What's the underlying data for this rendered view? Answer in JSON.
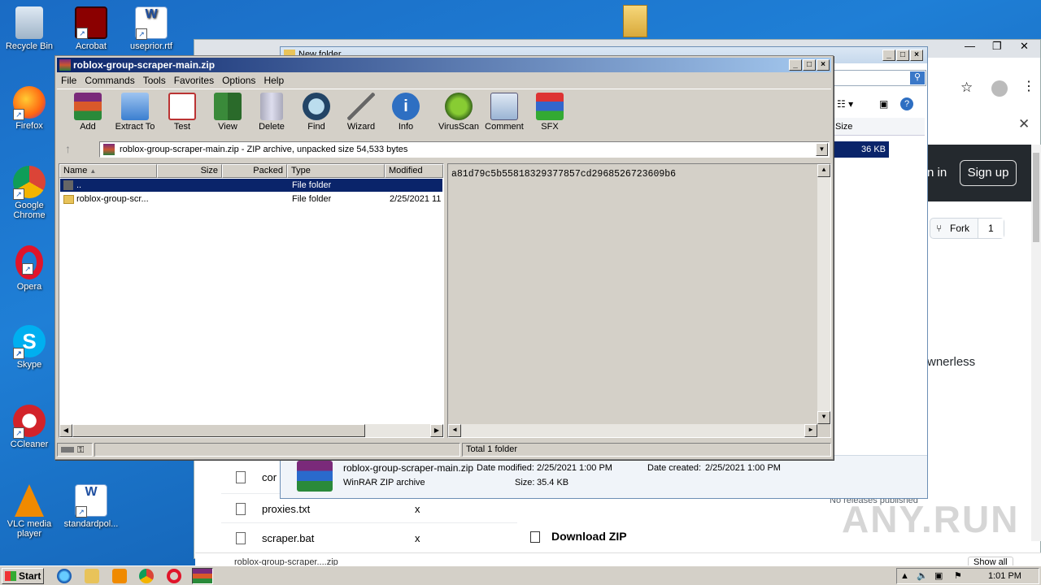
{
  "desktop": {
    "icons": [
      {
        "label": "Recycle Bin"
      },
      {
        "label": "Acrobat"
      },
      {
        "label": "useprior.rtf"
      },
      {
        "label": "Firefox"
      },
      {
        "label": "Google Chrome"
      },
      {
        "label": "Opera"
      },
      {
        "label": "Skype"
      },
      {
        "label": "CCleaner"
      },
      {
        "label": "VLC media player"
      },
      {
        "label": "standardpol..."
      }
    ]
  },
  "browser": {
    "signin": "n in",
    "signup": "Sign up",
    "fork_label": "Fork",
    "fork_count": "1",
    "ownerless": "wnerless",
    "download_zip": "Download ZIP",
    "no_releases": "No releases published",
    "files": [
      {
        "name": "cor",
        "x": ""
      },
      {
        "name": "proxies.txt",
        "x": "x"
      },
      {
        "name": "scraper.bat",
        "x": "x"
      }
    ],
    "download_item": "roblox-group-scraper....zip",
    "show_all": "Show all"
  },
  "explorer": {
    "title": "New folder",
    "size_header": "Size",
    "size_value": "36 KB",
    "details": {
      "name": "roblox-group-scraper-main.zip",
      "type": "WinRAR ZIP archive",
      "modified_label": "Date modified:",
      "modified": "2/25/2021 1:00 PM",
      "created_label": "Date created:",
      "created": "2/25/2021 1:00 PM",
      "size_label": "Size:",
      "size": "35.4 KB"
    }
  },
  "winrar": {
    "title": "roblox-group-scraper-main.zip",
    "menu": [
      "File",
      "Commands",
      "Tools",
      "Favorites",
      "Options",
      "Help"
    ],
    "toolbar": [
      "Add",
      "Extract To",
      "Test",
      "View",
      "Delete",
      "Find",
      "Wizard",
      "Info",
      "VirusScan",
      "Comment",
      "SFX"
    ],
    "address": "roblox-group-scraper-main.zip - ZIP archive, unpacked size 54,533 bytes",
    "columns": [
      "Name",
      "Size",
      "Packed",
      "Type",
      "Modified"
    ],
    "rows": [
      {
        "name": "..",
        "size": "",
        "packed": "",
        "type": "File folder",
        "modified": ""
      },
      {
        "name": "roblox-group-scr...",
        "size": "",
        "packed": "",
        "type": "File folder",
        "modified": "2/25/2021 11"
      }
    ],
    "comment": "a81d79c5b55818329377857cd2968526723609b6",
    "status": "Total 1 folder"
  },
  "taskbar": {
    "start": "Start",
    "clock": "1:01 PM"
  },
  "watermark": "ANY.RUN"
}
